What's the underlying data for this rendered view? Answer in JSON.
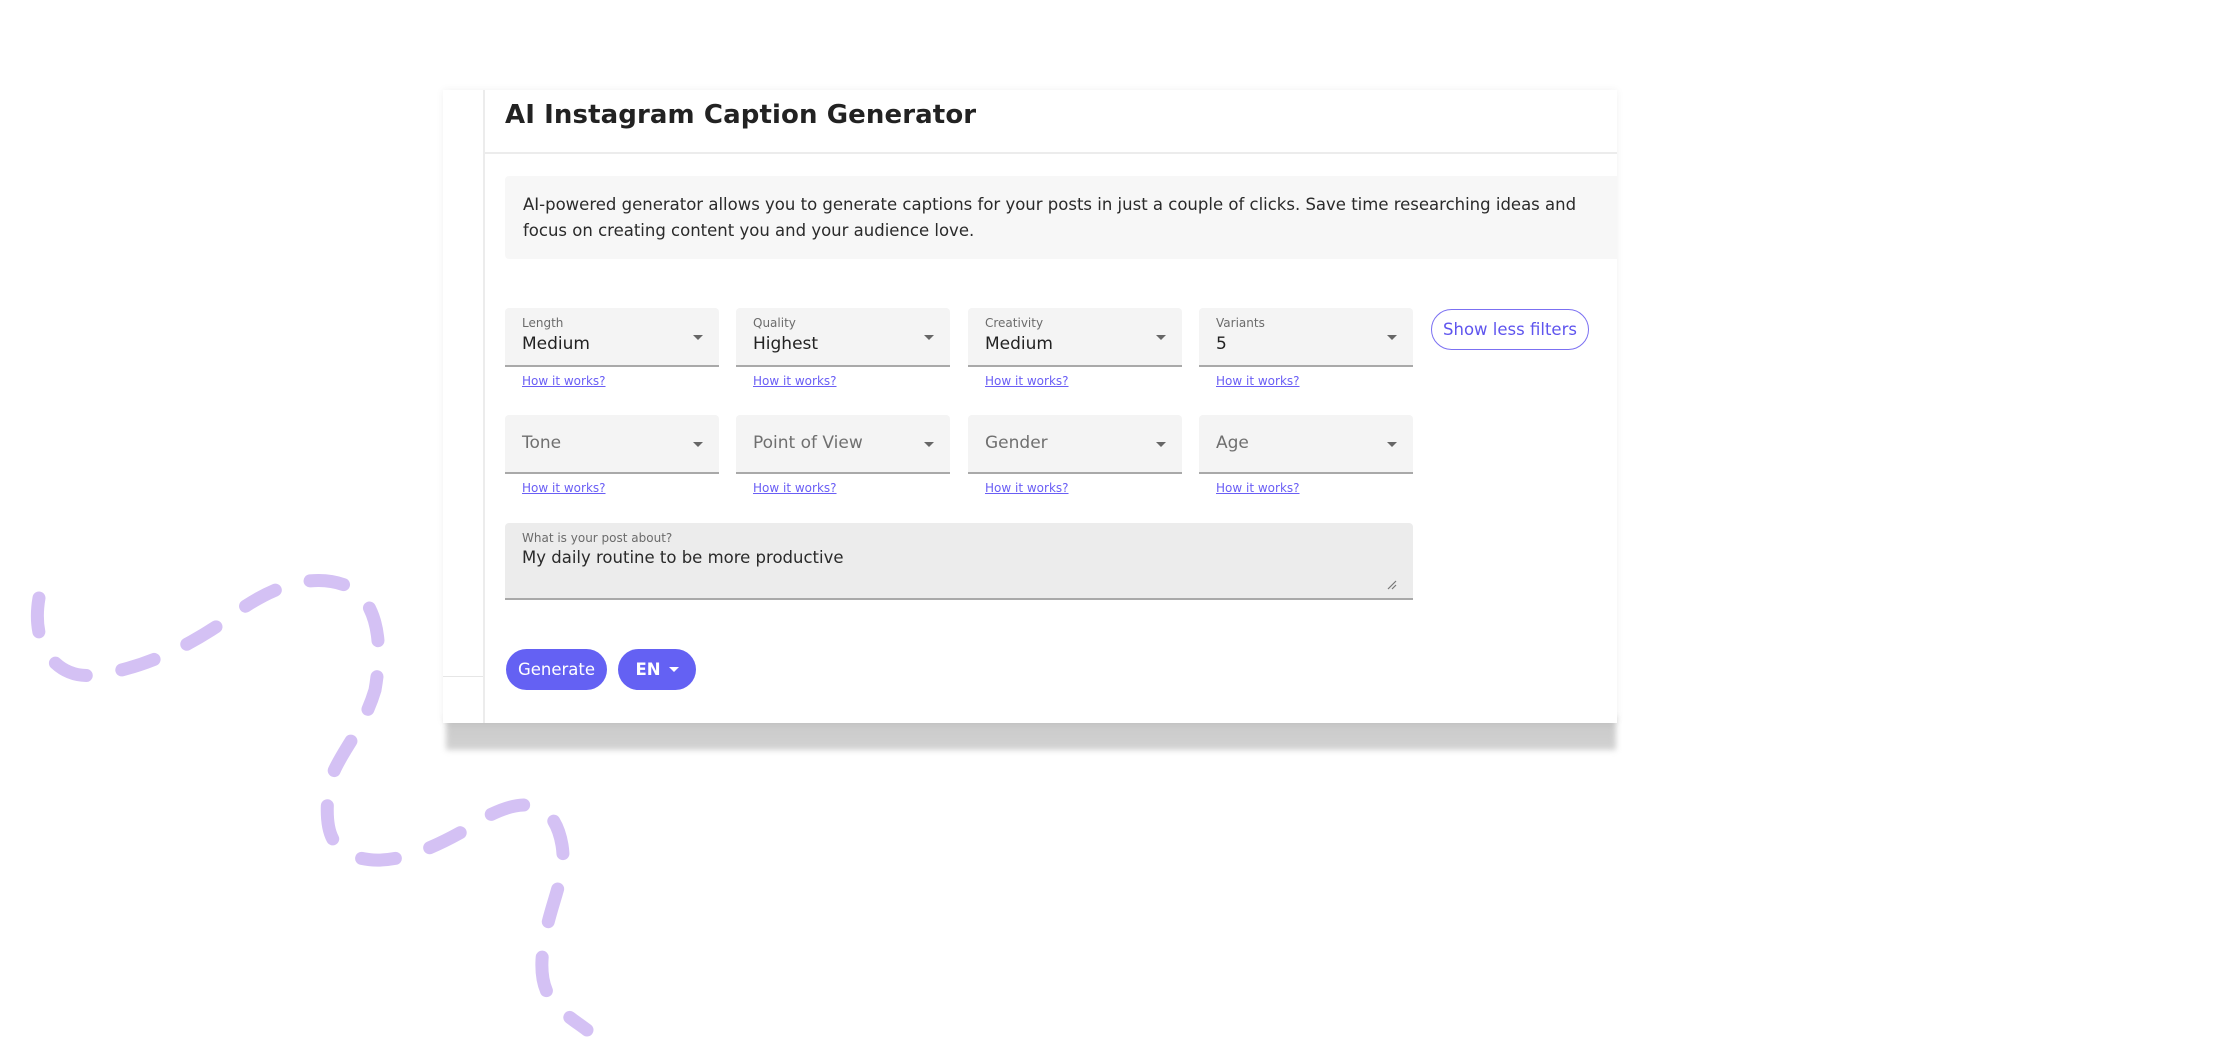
{
  "app": {
    "title": "AI Instagram Caption Generator",
    "description": "AI-powered generator allows you to generate captions for your posts in just a couple of clicks. Save time researching ideas and focus on creating content you and your audience love."
  },
  "filters": {
    "row1": [
      {
        "label": "Length",
        "value": "Medium",
        "help": "How it works?"
      },
      {
        "label": "Quality",
        "value": "Highest",
        "help": "How it works?"
      },
      {
        "label": "Creativity",
        "value": "Medium",
        "help": "How it works?"
      },
      {
        "label": "Variants",
        "value": "5",
        "help": "How it works?"
      }
    ],
    "row2": [
      {
        "placeholder": "Tone",
        "help": "How it works?"
      },
      {
        "placeholder": "Point of View",
        "help": "How it works?"
      },
      {
        "placeholder": "Gender",
        "help": "How it works?"
      },
      {
        "placeholder": "Age",
        "help": "How it works?"
      }
    ],
    "toggle_label": "Show less filters"
  },
  "post": {
    "label": "What is your post about?",
    "value": "My daily routine to be more productive"
  },
  "actions": {
    "generate_label": "Generate",
    "language_label": "EN"
  },
  "colors": {
    "accent": "#6461f3",
    "link": "#6a5ef5",
    "decoration": "#d4c1f4"
  }
}
